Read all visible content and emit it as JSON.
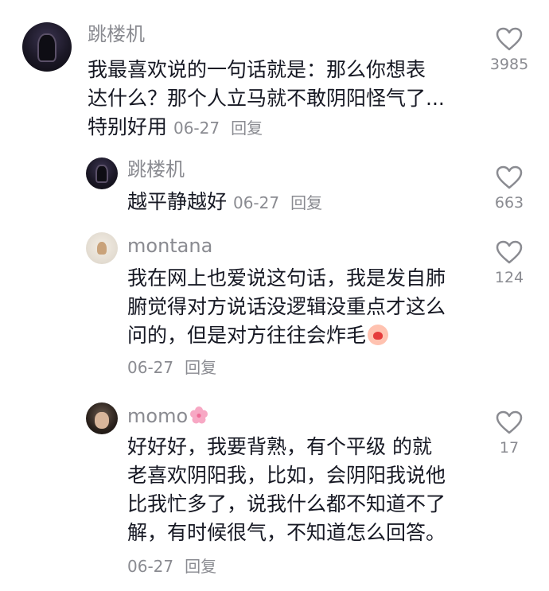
{
  "comments": [
    {
      "user": "跳楼机",
      "lines": [
        "我最喜欢说的一句话就是：那么你想表",
        "达什么？那个人立马就不敢阴阳怪气了..."
      ],
      "last_line": "特别好用",
      "date": "06-27",
      "reply": "回复",
      "likes": "3985"
    },
    {
      "user": "跳楼机",
      "last_line": "越平静越好",
      "date": "06-27",
      "reply": "回复",
      "likes": "663"
    },
    {
      "user": "montana",
      "lines": [
        "我在网上也爱说这句话，我是发自肺",
        "腑觉得对方说话没逻辑没重点才这么"
      ],
      "last_line": "问的，但是对方往往会炸毛",
      "emoji": "crying-face-emoji",
      "date": "06-27",
      "reply": "回复",
      "likes": "124"
    },
    {
      "user": "momo",
      "user_emoji": "cherry-blossom-emoji",
      "lines": [
        "好好好，我要背熟，有个平级 的就",
        "老喜欢阴阳我，比如，会阴阳我说他",
        "比我忙多了，说我什么都不知道不了",
        "解，有时候很气，不知道怎么回答。"
      ],
      "date": "06-27",
      "reply": "回复",
      "likes": "17"
    }
  ],
  "icons": {
    "like": "heart-outline-icon"
  },
  "colors": {
    "text": "#161823",
    "secondary": "#8a8b91",
    "background": "#ffffff"
  }
}
